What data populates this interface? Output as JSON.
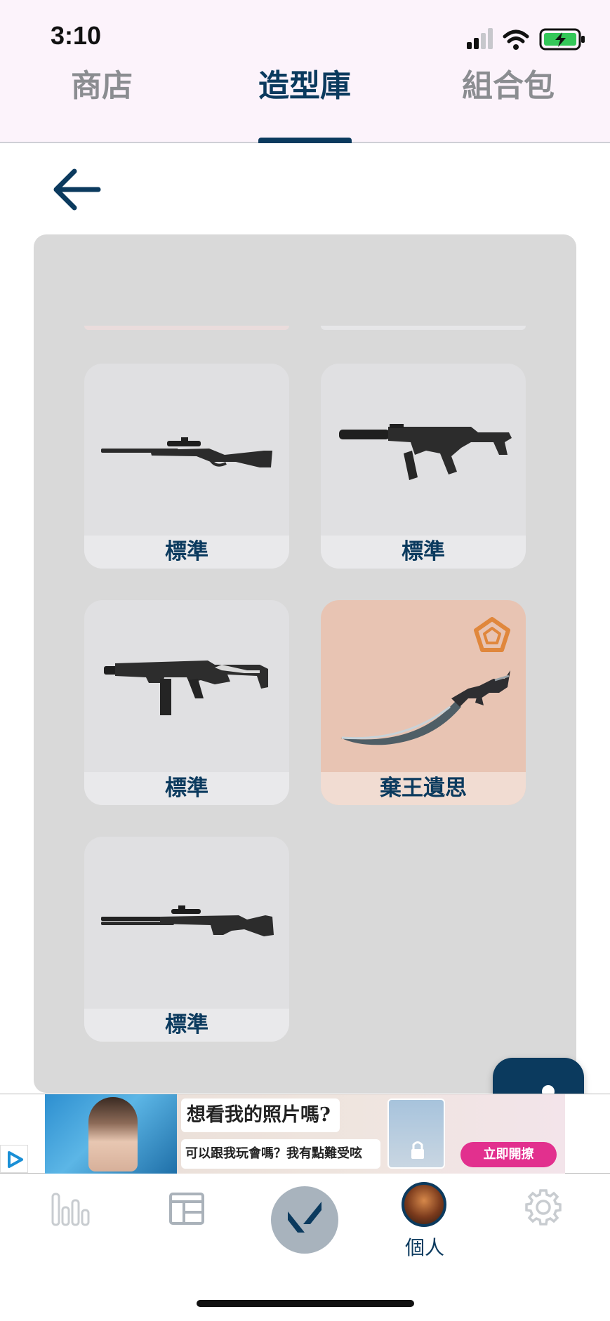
{
  "status_bar": {
    "time": "3:10",
    "icons": [
      "cellular-signal-icon",
      "wifi-icon",
      "battery-charging-icon"
    ]
  },
  "top_tabs": [
    {
      "label": "商店",
      "active": false
    },
    {
      "label": "造型庫",
      "active": true
    },
    {
      "label": "組合包",
      "active": false
    }
  ],
  "header": {
    "back_icon": "arrow-left-icon"
  },
  "skins": [
    {
      "name": "標準",
      "weapon": "rifle-scoped-lever-icon",
      "premium": false
    },
    {
      "name": "標準",
      "weapon": "smg-suppressed-icon",
      "premium": false
    },
    {
      "name": "標準",
      "weapon": "smg-folding-stock-icon",
      "premium": false
    },
    {
      "name": "棄王遺思",
      "weapon": "curved-knife-icon",
      "premium": true,
      "tier_icon": "pentagon-tier-icon"
    },
    {
      "name": "標準",
      "weapon": "shotgun-scoped-icon",
      "premium": false
    }
  ],
  "share_button": {
    "icon": "share-icon"
  },
  "ad": {
    "headline": "想看我的照片嗎?",
    "subline": "可以跟我玩會嗎？我有點難受呟",
    "cta": "立即開撩",
    "badge_icon": "ad-choices-icon",
    "lock_icon": "lock-icon"
  },
  "bottom_nav": [
    {
      "icon": "stats-bars-icon",
      "label": ""
    },
    {
      "icon": "news-icon",
      "label": ""
    },
    {
      "icon": "valorant-logo-icon",
      "label": ""
    },
    {
      "icon": "profile-avatar-icon",
      "label": "個人",
      "active": true
    },
    {
      "icon": "gear-icon",
      "label": ""
    }
  ],
  "colors": {
    "accent": "#0b3a5e",
    "panel": "#d9d9d9",
    "premium_card": "#e8c4b3",
    "tier": "#e0873c"
  }
}
